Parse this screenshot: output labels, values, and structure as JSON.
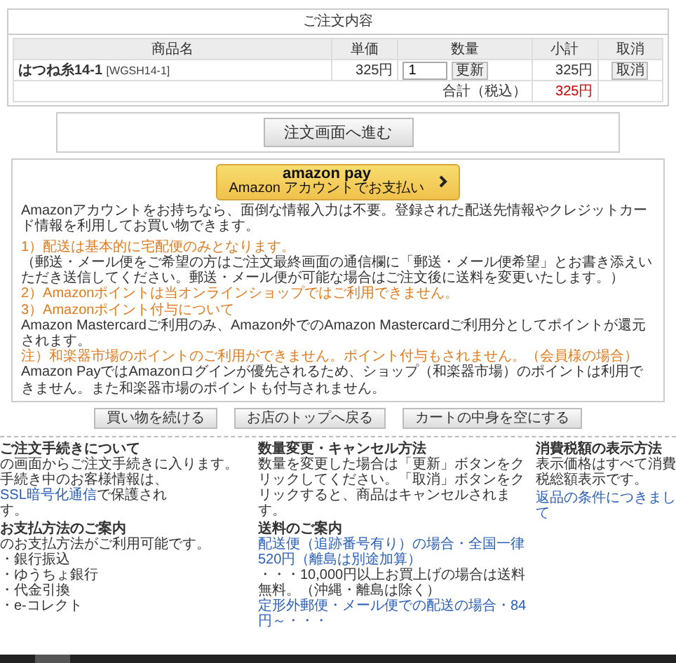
{
  "order": {
    "title": "ご注文内容",
    "columns": [
      "商品名",
      "単価",
      "数量",
      "小計",
      "取消"
    ],
    "items": [
      {
        "name": "はつね糸14-1",
        "code": "[WGSH14-1]",
        "price": "325円",
        "quantity": "1",
        "update_button": "更新",
        "subtotal": "325円",
        "cancel_button": "取消"
      }
    ],
    "total_label": "合計（税込）",
    "total": "325円"
  },
  "proceed_button": "注文画面へ進む",
  "amazon_pay": {
    "logo": "amazon pay",
    "caption": "Amazon アカウントでお支払い",
    "intro": "Amazonアカウントをお持ちなら、面倒な情報入力は不要。登録された配送先情報やクレジットカード情報を利用してお買い物できます。",
    "notes": [
      {
        "kind": "notice",
        "text": "1）配送は基本的に宅配便のみとなります。"
      },
      {
        "kind": "plain",
        "text": "（郵送・メール便をご希望の方はご注文最終画面の通信欄に「郵送・メール便希望」とお書き添えいただき送信してください。郵送・メール便が可能な場合はご注文後に送料を変更いたします。）"
      },
      {
        "kind": "notice",
        "text": "2）Amazonポイントは当オンラインショップではご利用できません。"
      },
      {
        "kind": "notice",
        "text": "3）Amazonポイント付与について"
      },
      {
        "kind": "plain",
        "text": "Amazon Mastercardご利用のみ、Amazon外でのAmazon Mastercardご利用分としてポイントが還元されます。"
      },
      {
        "kind": "notice",
        "text": "注）和楽器市場のポイントのご利用ができません。ポイント付与もされません。（会員様の場合）"
      },
      {
        "kind": "plain",
        "text": "Amazon PayではAmazonログインが優先されるため、ショップ（和楽器市場）のポイントは利用できません。また和楽器市場のポイントも付与されません。"
      }
    ]
  },
  "cart_buttons": [
    "買い物を続ける",
    "お店のトップへ戻る",
    "カートの中身を空にする"
  ],
  "footer": {
    "columns": [
      {
        "sections": [
          {
            "title": "ご注文手続きについて",
            "lines": [
              [
                {
                  "text": "の画面からご注文手続きに入ります。",
                  "link": false
                }
              ],
              [
                {
                  "text": "手続き中のお客様情報は、",
                  "link": false
                },
                {
                  "text": "SSL暗号化通信",
                  "link": true
                },
                {
                  "text": "で保護され",
                  "link": false
                }
              ],
              [
                {
                  "text": "す。",
                  "link": false
                }
              ]
            ]
          },
          {
            "title": "お支払方法のご案内",
            "lines": [
              [
                {
                  "text": "のお支払方法がご利用可能です。",
                  "link": false
                }
              ],
              [
                {
                  "text": "・銀行振込",
                  "link": false
                }
              ],
              [
                {
                  "text": "・ゆうちょ銀行",
                  "link": false
                }
              ],
              [
                {
                  "text": "・代金引換",
                  "link": false
                }
              ],
              [
                {
                  "text": "・e-コレクト",
                  "link": false
                }
              ]
            ]
          }
        ]
      },
      {
        "sections": [
          {
            "title": "数量変更・キャンセル方法",
            "lines": [
              [
                {
                  "text": "数量を変更した場合は「更新」ボタンをクリックしてください。「取消」ボタンをクリックすると、商品はキャンセルされます。",
                  "link": false
                }
              ]
            ]
          },
          {
            "title": "送料のご案内",
            "lines": [
              [
                {
                  "text": "配送便（追跡番号有り）の場合・全国一律520円（離島は別途加算）",
                  "link": true
                }
              ],
              [
                {
                  "text": "・・・10,000円以上お買上げの場合は送料無料。（沖縄・離島は除く）",
                  "link": false
                }
              ],
              [
                {
                  "text": "定形外郵便・メール便での配送の場合・84円～・・・",
                  "link": true
                }
              ]
            ]
          }
        ]
      },
      {
        "sections": [
          {
            "title": "消費税額の表示方法",
            "lines": [
              [
                {
                  "text": "表示価格はすべて消費税総額表示です。",
                  "link": false
                }
              ]
            ]
          },
          {
            "lines": [
              [
                {
                  "text": "返品の条件につきまして",
                  "link": true
                }
              ]
            ]
          }
        ]
      }
    ]
  }
}
